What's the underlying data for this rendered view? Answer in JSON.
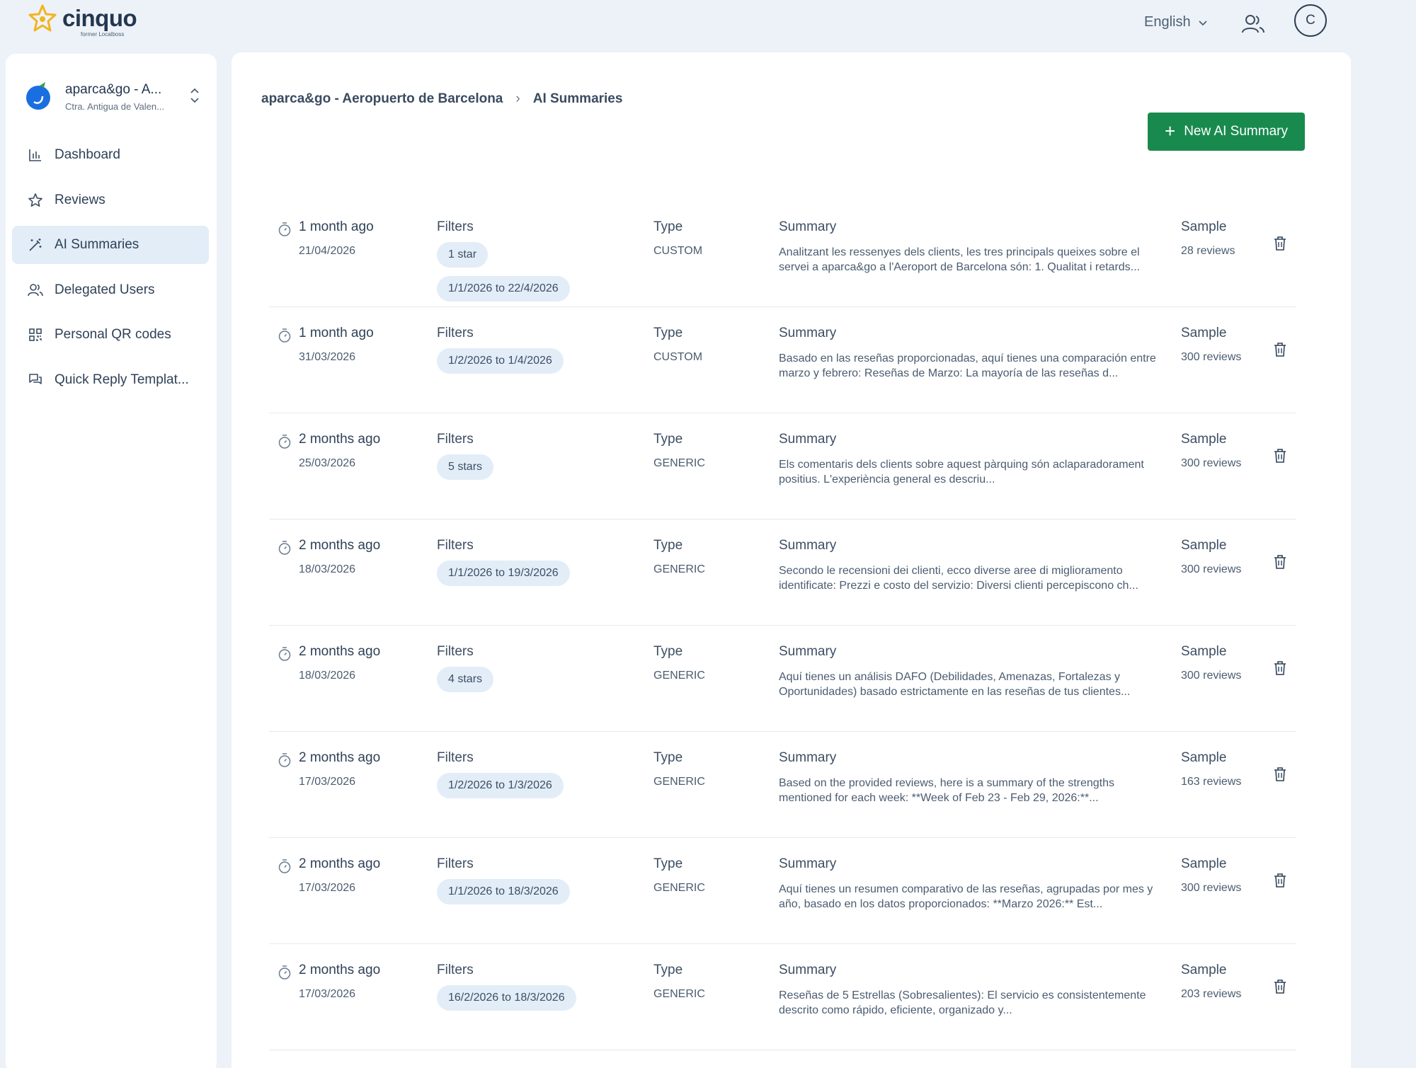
{
  "brand": {
    "name": "cinquo",
    "tagline": "former Localboss",
    "accent_color": "#198a4e"
  },
  "header": {
    "language": "English",
    "users_icon": "users-icon",
    "avatar_initial": "C"
  },
  "sidebar": {
    "location": {
      "name": "aparca&go - A...",
      "address": "Ctra. Antigua de Valen..."
    },
    "items": [
      {
        "label": "Dashboard",
        "icon": "bar-chart-icon",
        "active": false
      },
      {
        "label": "Reviews",
        "icon": "star-icon",
        "active": false
      },
      {
        "label": "AI Summaries",
        "icon": "magic-wand-icon",
        "active": true
      },
      {
        "label": "Delegated Users",
        "icon": "users-icon",
        "active": false
      },
      {
        "label": "Personal QR codes",
        "icon": "qr-code-icon",
        "active": false
      },
      {
        "label": "Quick Reply Templat...",
        "icon": "chat-bubbles-icon",
        "active": false
      }
    ]
  },
  "main": {
    "breadcrumb": {
      "parent": "aparca&go - Aeropuerto de Barcelona",
      "current": "AI Summaries"
    },
    "new_button_label": "New AI Summary",
    "labels": {
      "filters": "Filters",
      "type": "Type",
      "summary": "Summary",
      "sample": "Sample"
    },
    "rows": [
      {
        "ago": "1 month ago",
        "date": "21/04/2026",
        "filters": [
          "1 star",
          "1/1/2026 to 22/4/2026"
        ],
        "type": "CUSTOM",
        "summary": "Analitzant les ressenyes dels clients, les tres principals queixes sobre el servei a aparca&go a l'Aeroport de Barcelona són: 1. Qualitat i retards...",
        "sample": "28 reviews"
      },
      {
        "ago": "1 month ago",
        "date": "31/03/2026",
        "filters": [
          "1/2/2026 to 1/4/2026"
        ],
        "type": "CUSTOM",
        "summary": "Basado en las reseñas proporcionadas, aquí tienes una comparación entre marzo y febrero: Reseñas de Marzo: La mayoría de las reseñas d...",
        "sample": "300 reviews"
      },
      {
        "ago": "2 months ago",
        "date": "25/03/2026",
        "filters": [
          "5 stars"
        ],
        "type": "GENERIC",
        "summary": "Els comentaris dels clients sobre aquest pàrquing són aclaparadorament positius. L'experiència general es descriu...",
        "sample": "300 reviews"
      },
      {
        "ago": "2 months ago",
        "date": "18/03/2026",
        "filters": [
          "1/1/2026 to 19/3/2026"
        ],
        "type": "GENERIC",
        "summary": "Secondo le recensioni dei clienti, ecco diverse aree di miglioramento identificate: Prezzi e costo del servizio: Diversi clienti percepiscono ch...",
        "sample": "300 reviews"
      },
      {
        "ago": "2 months ago",
        "date": "18/03/2026",
        "filters": [
          "4 stars"
        ],
        "type": "GENERIC",
        "summary": "Aquí tienes un análisis DAFO (Debilidades, Amenazas, Fortalezas y Oportunidades) basado estrictamente en las reseñas de tus clientes...",
        "sample": "300 reviews"
      },
      {
        "ago": "2 months ago",
        "date": "17/03/2026",
        "filters": [
          "1/2/2026 to 1/3/2026"
        ],
        "type": "GENERIC",
        "summary": "Based on the provided reviews, here is a summary of the strengths mentioned for each week: **Week of Feb 23 - Feb 29, 2026:**...",
        "sample": "163 reviews"
      },
      {
        "ago": "2 months ago",
        "date": "17/03/2026",
        "filters": [
          "1/1/2026 to 18/3/2026"
        ],
        "type": "GENERIC",
        "summary": "Aquí tienes un resumen comparativo de las reseñas, agrupadas por mes y año, basado en los datos proporcionados: **Marzo 2026:** Est...",
        "sample": "300 reviews"
      },
      {
        "ago": "2 months ago",
        "date": "17/03/2026",
        "filters": [
          "16/2/2026 to 18/3/2026"
        ],
        "type": "GENERIC",
        "summary": "Reseñas de 5 Estrellas (Sobresalientes): El servicio es consistentemente descrito como rápido, eficiente, organizado y...",
        "sample": "203 reviews"
      }
    ]
  }
}
